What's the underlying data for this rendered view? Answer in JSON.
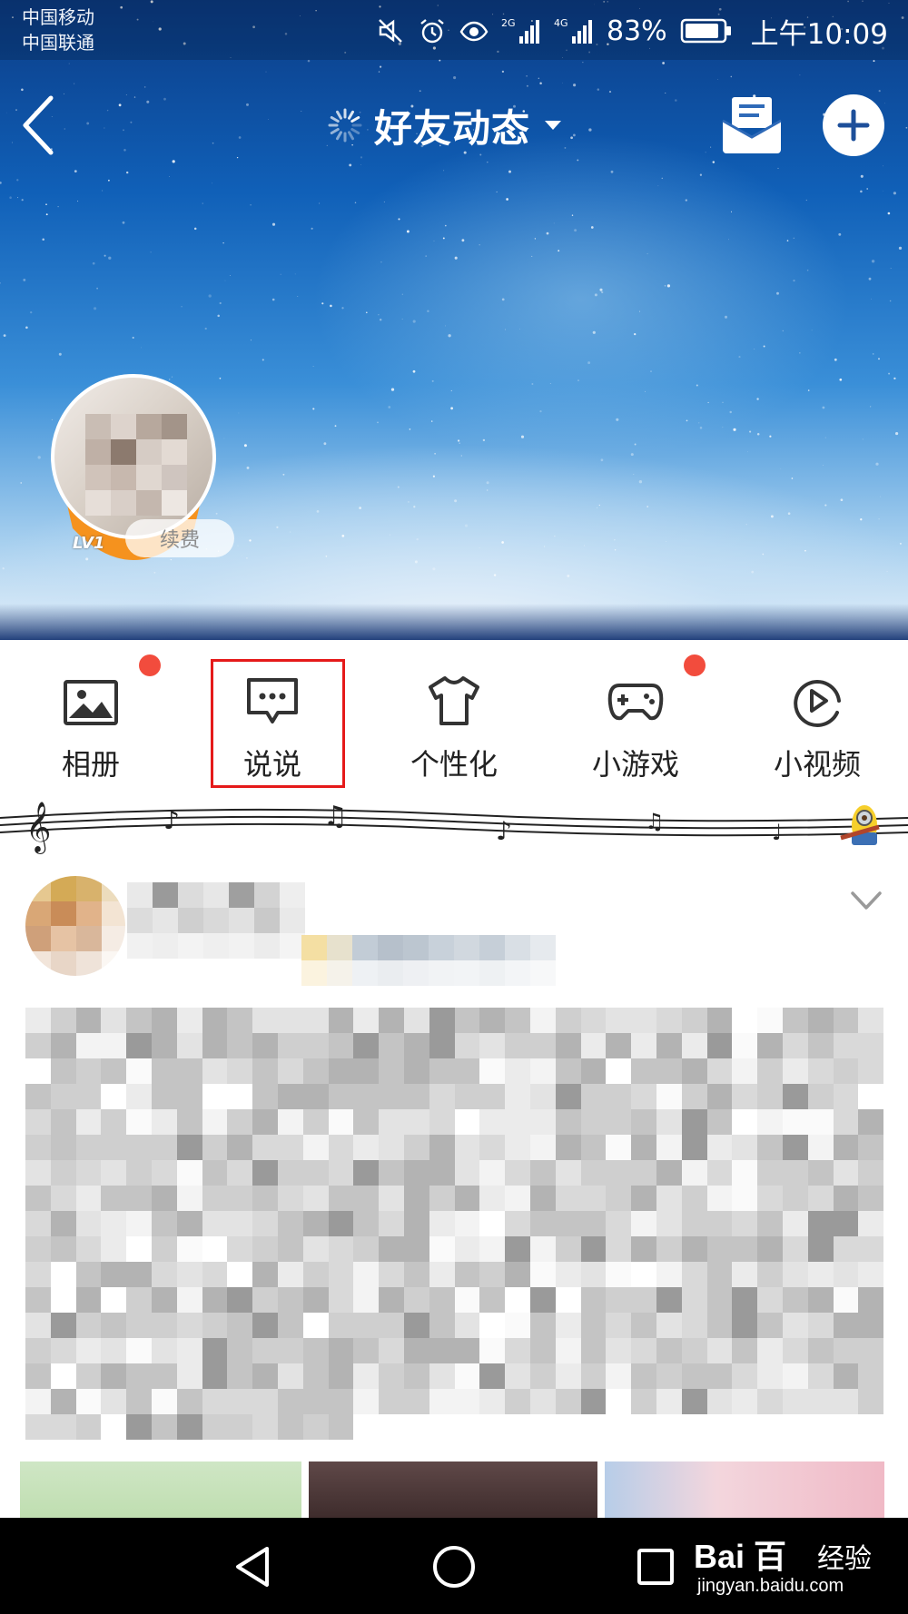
{
  "status_bar": {
    "carrier_1": "中国移动",
    "carrier_2": "中国联通",
    "net_2g": "2G",
    "net_4g": "4G",
    "battery": "83%",
    "time": "上午10:09"
  },
  "nav": {
    "title": "好友动态"
  },
  "profile": {
    "level": "LV1",
    "renew_label": "续费"
  },
  "menu": {
    "items": [
      {
        "label": "相册",
        "icon": "photo-album-icon",
        "badge": true
      },
      {
        "label": "说说",
        "icon": "chat-bubble-icon",
        "badge": false,
        "highlighted": true
      },
      {
        "label": "个性化",
        "icon": "tshirt-icon",
        "badge": false
      },
      {
        "label": "小游戏",
        "icon": "gamepad-icon",
        "badge": true
      },
      {
        "label": "小视频",
        "icon": "play-circle-icon",
        "badge": false
      }
    ]
  },
  "watermark": {
    "brand": "Bai 百",
    "jingyan": "经验",
    "url": "jingyan.baidu.com"
  },
  "colors": {
    "badge_red": "#f24c3d",
    "highlight_red": "#e51a1a",
    "sky_top": "#0b3c86",
    "accent_orange": "#f5921e"
  }
}
